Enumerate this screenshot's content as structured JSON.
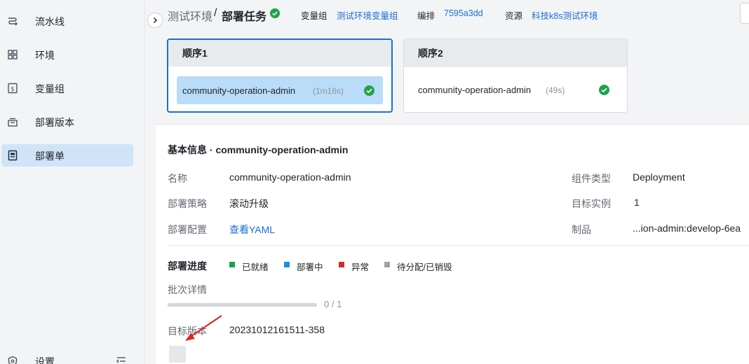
{
  "sidebar": {
    "items": [
      {
        "label": "流水线",
        "icon": "pipeline-icon"
      },
      {
        "label": "环境",
        "icon": "grid-icon"
      },
      {
        "label": "变量组",
        "icon": "variable-icon"
      },
      {
        "label": "部署版本",
        "icon": "archive-icon"
      },
      {
        "label": "部署单",
        "icon": "document-icon",
        "active": true
      },
      {
        "label": "设置",
        "icon": "shield-icon"
      }
    ]
  },
  "header": {
    "breadcrumb_env": "测试环境",
    "breadcrumb_sep": "/",
    "breadcrumb_task": "部署任务",
    "var_group_label": "变量组",
    "var_group_value": "测试环境变量组",
    "orchestration_label": "编排",
    "orchestration_value": "7595a3dd",
    "resource_label": "资源",
    "resource_value": "科技k8s测试环境"
  },
  "stages": [
    {
      "title": "顺序1",
      "task": "community-operation-admin",
      "duration": "(1m16s)",
      "status": "success"
    },
    {
      "title": "顺序2",
      "task": "community-operation-admin",
      "duration": "(49s)",
      "status": "success"
    }
  ],
  "detail": {
    "title": "基本信息 · community-operation-admin",
    "name_label": "名称",
    "name_value": "community-operation-admin",
    "strategy_label": "部署策略",
    "strategy_value": "滚动升级",
    "config_label": "部署配置",
    "config_link": "查看YAML",
    "component_type_label": "组件类型",
    "component_type_value": "Deployment",
    "target_instances_label": "目标实例",
    "target_instances_value": "1",
    "artifact_label": "制品",
    "artifact_value": "...ion-admin:develop-6ea"
  },
  "progress": {
    "title": "部署进度",
    "legend": [
      {
        "label": "已就绪",
        "color": "#16a34a"
      },
      {
        "label": "部署中",
        "color": "#1a8fe3"
      },
      {
        "label": "异常",
        "color": "#d42a2a"
      },
      {
        "label": "待分配/已销毁",
        "color": "#9ca3af"
      }
    ],
    "batch_label": "批次详情",
    "batch_done": 0,
    "batch_total": 1,
    "batch_count": "0 / 1",
    "target_version_label": "目标版本",
    "target_version_value": "20231012161511-358"
  },
  "colors": {
    "accent": "#1a6fd6",
    "success": "#1fa34a",
    "active_bg": "#cfe4f9",
    "annotation_arrow": "#e02424"
  }
}
